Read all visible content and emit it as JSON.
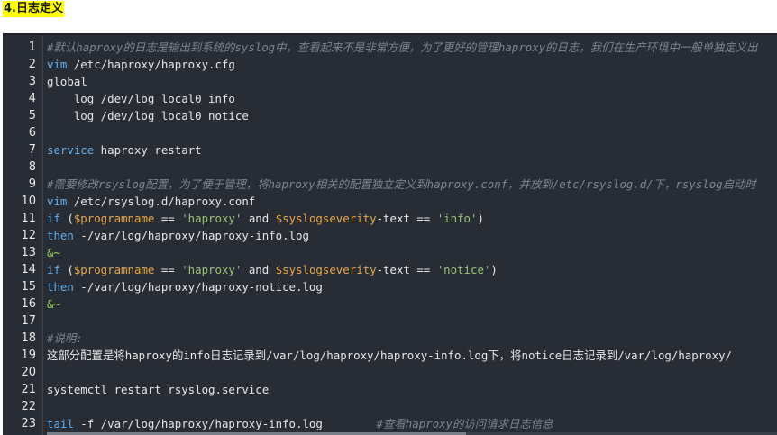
{
  "heading": "4.日志定义",
  "gutter": [
    "1",
    "2",
    "3",
    "4",
    "5",
    "6",
    "7",
    "8",
    "9",
    "10",
    "11",
    "12",
    "13",
    "14",
    "15",
    "16",
    "17",
    "18",
    "19",
    "20",
    "21",
    "22",
    "23"
  ],
  "lines": {
    "l1": {
      "c": "#默认haproxy的日志是输出到系统的syslog中，查看起来不是非常方便，为了更好的管理haproxy的日志，我们在生产环境中一般单独定义出"
    },
    "l2": {
      "kw": "vim",
      "rest": " /etc/haproxy/haproxy.cfg"
    },
    "l3": {
      "t": "global"
    },
    "l4": {
      "t": "    log /dev/log local0 info"
    },
    "l5": {
      "t": "    log /dev/log local0 notice"
    },
    "l6": {},
    "l7": {
      "kw": "service",
      "rest": " haproxy restart"
    },
    "l8": {},
    "l9": {
      "c": "#需要修改rsyslog配置，为了便于管理，将haproxy相关的配置独立定义到haproxy.conf，并放到/etc/rsyslog.d/下，rsyslog启动时"
    },
    "l10": {
      "kw": "vim",
      "rest": " /etc/rsyslog.d/haproxy.conf"
    },
    "l11": {
      "kw": "if",
      "p1": " (",
      "v1": "$programname",
      "op1": " == ",
      "s1": "'haproxy'",
      "and": " and ",
      "v2": "$syslogseverity",
      "p2": "-text == ",
      "s2": "'info'",
      "p3": ")"
    },
    "l12": {
      "kw": "then",
      "rest": " -/var/log/haproxy/haproxy-info.log"
    },
    "l13": {
      "amp": "&~"
    },
    "l14": {
      "kw": "if",
      "p1": " (",
      "v1": "$programname",
      "op1": " == ",
      "s1": "'haproxy'",
      "and": " and ",
      "v2": "$syslogseverity",
      "p2": "-text == ",
      "s2": "'notice'",
      "p3": ")"
    },
    "l15": {
      "kw": "then",
      "rest": " -/var/log/haproxy/haproxy-notice.log"
    },
    "l16": {
      "amp": "&~"
    },
    "l17": {},
    "l18": {
      "c": "#说明:"
    },
    "l19": {
      "t": "这部分配置是将haproxy的info日志记录到/var/log/haproxy/haproxy-info.log下，将notice日志记录到/var/log/haproxy/"
    },
    "l20": {},
    "l21": {
      "t": "systemctl restart rsyslog.service"
    },
    "l22": {},
    "l23": {
      "kw": "tail",
      "rest": " -f /var/log/haproxy/haproxy-info.log        ",
      "c": "#查看haproxy的访问请求日志信息"
    }
  },
  "colors": {
    "background": "#282c34",
    "comment": "#7d8493",
    "keyword": "#61afef",
    "variable": "#e5a84a",
    "string": "#98c379",
    "text": "#e6e6e6",
    "heading_highlight": "#ffff00"
  }
}
